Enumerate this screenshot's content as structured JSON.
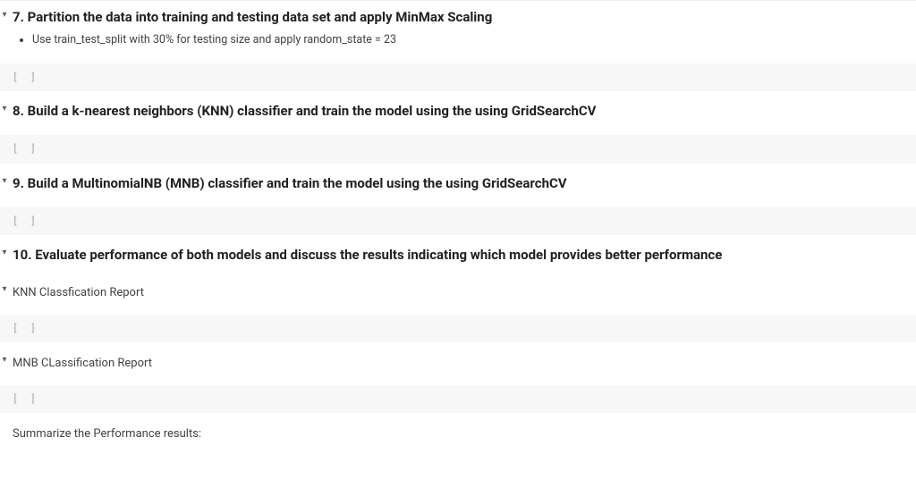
{
  "cells": {
    "s7": {
      "heading": "7. Partition the data into training and testing data set and apply MinMax Scaling",
      "bullet1": "Use train_test_split with 30% for testing size and apply random_state = 23"
    },
    "s8": {
      "heading": "8. Build a k-nearest neighbors (KNN) classifier and train the model using the using GridSearchCV"
    },
    "s9": {
      "heading": "9. Build a MultinomialNB (MNB) classifier and train the model using the using GridSearchCV"
    },
    "s10": {
      "heading": "10. Evaluate performance of both models and discuss the results indicating which model provides better performance"
    },
    "knn_report": {
      "text": "KNN Classfication Report"
    },
    "mnb_report": {
      "text": "MNB CLassification Report"
    },
    "summary": {
      "text": "Summarize the Performance results:"
    },
    "code_prompt": "[ ]"
  },
  "icons": {
    "collapse": "▾"
  }
}
